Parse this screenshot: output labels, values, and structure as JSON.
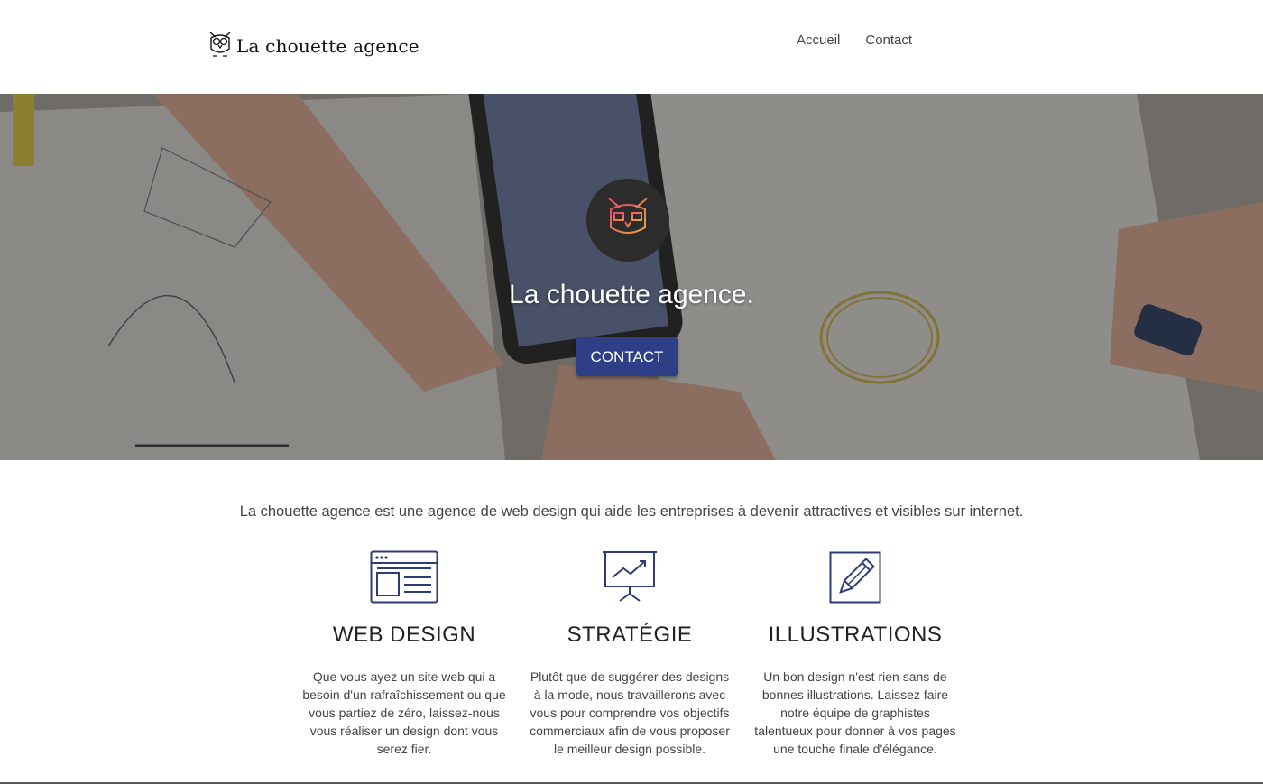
{
  "header": {
    "logo_text": "La chouette agence",
    "nav": [
      {
        "label": "Accueil"
      },
      {
        "label": "Contact"
      }
    ]
  },
  "hero": {
    "title": "La chouette agence.",
    "button_label": "CONTACT"
  },
  "intro": {
    "text": "La chouette agence est une agence de web design qui aide les entreprises à devenir attractives et visibles sur internet."
  },
  "services": [
    {
      "icon": "browser-window-icon",
      "title": "WEB DESIGN",
      "text": "Que vous ayez un site web qui a besoin d'un rafraîchissement ou que vous partiez de zéro, laissez-nous vous réaliser un design dont vous serez fier."
    },
    {
      "icon": "presentation-chart-icon",
      "title": "STRATÉGIE",
      "text": "Plutôt que de suggérer des designs à la mode, nous travaillerons avec vous pour comprendre vos objectifs commerciaux afin de vous proposer le meilleur design possible."
    },
    {
      "icon": "pencil-icon",
      "title": "ILLUSTRATIONS",
      "text": "Un bon design n'est rien sans de bonnes illustrations. Laissez faire notre équipe de graphistes talentueux pour donner à vos pages une touche finale d'élégance."
    }
  ],
  "colors": {
    "accent": "#2f3f87",
    "icon_stroke": "#2f3a78"
  }
}
